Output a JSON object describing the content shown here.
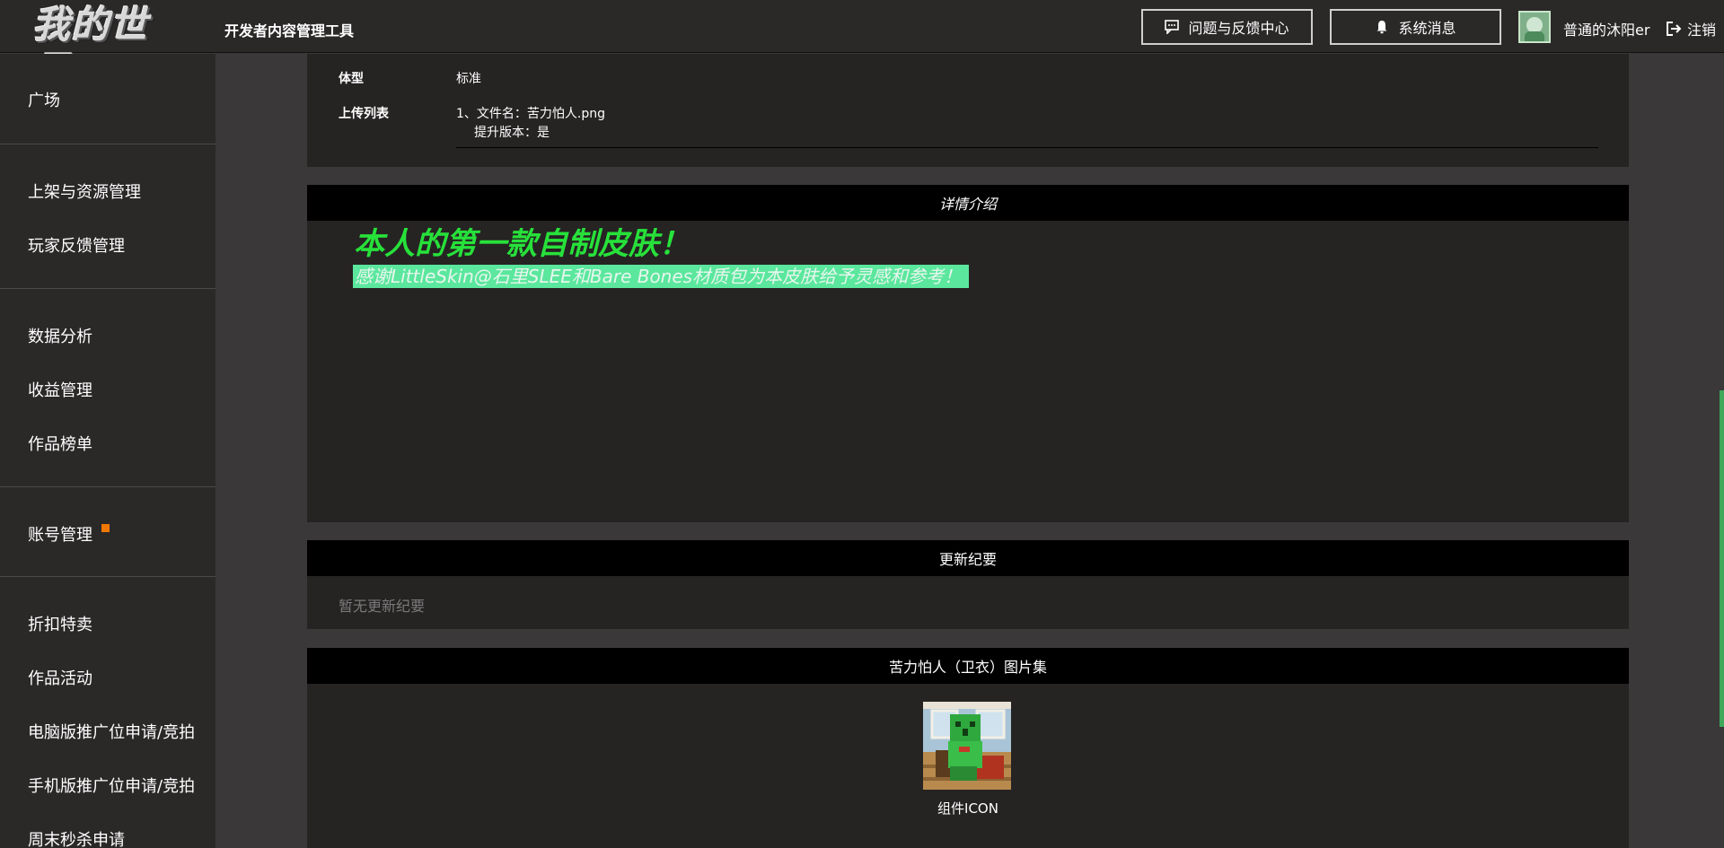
{
  "header": {
    "logo_text": "我的世界",
    "app_title": "开发者内容管理工具",
    "feedback_label": "问题与反馈中心",
    "messages_label": "系统消息",
    "username": "普通的沐阳er",
    "logout_label": "注销"
  },
  "sidebar": {
    "items": [
      {
        "label": "广场"
      },
      {
        "label": "上架与资源管理"
      },
      {
        "label": "玩家反馈管理"
      },
      {
        "label": "数据分析"
      },
      {
        "label": "收益管理"
      },
      {
        "label": "作品榜单"
      },
      {
        "label": "账号管理"
      },
      {
        "label": "折扣特卖"
      },
      {
        "label": "作品活动"
      },
      {
        "label": "电脑版推广位申请/竞拍"
      },
      {
        "label": "手机版推广位申请/竞拍"
      },
      {
        "label": "周末秒杀申请"
      }
    ]
  },
  "info": {
    "body_type_label": "体型",
    "body_type_value": "标准",
    "upload_label": "上传列表",
    "upload_line1": "1、文件名：苦力怕人.png",
    "upload_line2": "提升版本：是"
  },
  "details": {
    "title": "详情介绍",
    "heading": "本人的第一款自制皮肤！",
    "highlight": "感谢LittleSkin@石里SLEE和Bare Bones材质包为本皮肤给予灵感和参考！"
  },
  "changelog": {
    "title": "更新纪要",
    "empty": "暂无更新纪要"
  },
  "gallery": {
    "title": "苦力怕人（卫衣）图片集",
    "caption": "组件ICON"
  },
  "colors": {
    "accent_green": "#27e13a",
    "highlight_bg": "#5be79d",
    "badge_orange": "#f07800"
  }
}
